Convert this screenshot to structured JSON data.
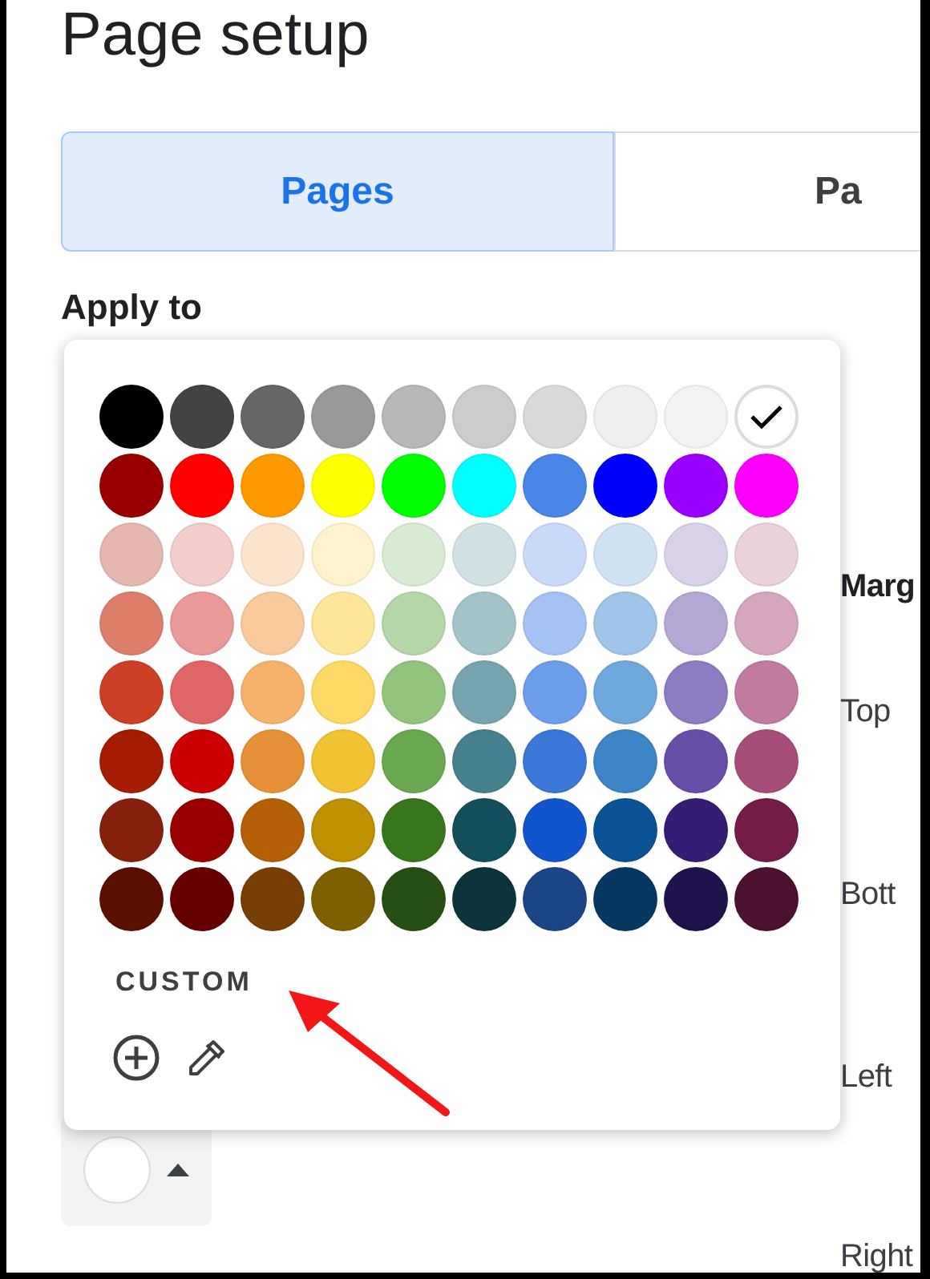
{
  "title": "Page setup",
  "tabs": [
    {
      "label": "Pages",
      "selected": true
    },
    {
      "label": "Pa",
      "selected": false
    }
  ],
  "apply_to": {
    "label": "Apply to"
  },
  "margins": {
    "heading": "Marg",
    "fields": [
      "Top",
      "Bott",
      "Left",
      "Right"
    ]
  },
  "color_button": {
    "color": "#ffffff"
  },
  "palette": {
    "rows": [
      [
        {
          "color": "#000000",
          "selected": false
        },
        {
          "color": "#434343",
          "selected": false
        },
        {
          "color": "#666666",
          "selected": false
        },
        {
          "color": "#999999",
          "selected": false
        },
        {
          "color": "#b7b7b7",
          "selected": false
        },
        {
          "color": "#cccccc",
          "selected": false
        },
        {
          "color": "#d9d9d9",
          "selected": false
        },
        {
          "color": "#efefef",
          "selected": false
        },
        {
          "color": "#f3f3f3",
          "selected": false
        },
        {
          "color": "#ffffff",
          "selected": true
        }
      ],
      [
        {
          "color": "#980000",
          "selected": false
        },
        {
          "color": "#ff0000",
          "selected": false
        },
        {
          "color": "#ff9900",
          "selected": false
        },
        {
          "color": "#ffff00",
          "selected": false
        },
        {
          "color": "#00ff00",
          "selected": false
        },
        {
          "color": "#00ffff",
          "selected": false
        },
        {
          "color": "#4a86e8",
          "selected": false
        },
        {
          "color": "#0000ff",
          "selected": false
        },
        {
          "color": "#9900ff",
          "selected": false
        },
        {
          "color": "#ff00ff",
          "selected": false
        }
      ],
      [
        {
          "color": "#e6b8af",
          "selected": false
        },
        {
          "color": "#f4cccc",
          "selected": false
        },
        {
          "color": "#fce5cd",
          "selected": false
        },
        {
          "color": "#fff2cc",
          "selected": false
        },
        {
          "color": "#d9ead3",
          "selected": false
        },
        {
          "color": "#d0e0e3",
          "selected": false
        },
        {
          "color": "#c9daf8",
          "selected": false
        },
        {
          "color": "#cfe2f3",
          "selected": false
        },
        {
          "color": "#d9d2e9",
          "selected": false
        },
        {
          "color": "#ead1dc",
          "selected": false
        }
      ],
      [
        {
          "color": "#dd7e6b",
          "selected": false
        },
        {
          "color": "#ea9999",
          "selected": false
        },
        {
          "color": "#f9cb9c",
          "selected": false
        },
        {
          "color": "#ffe599",
          "selected": false
        },
        {
          "color": "#b6d7a8",
          "selected": false
        },
        {
          "color": "#a2c4c9",
          "selected": false
        },
        {
          "color": "#a4c2f4",
          "selected": false
        },
        {
          "color": "#9fc5e8",
          "selected": false
        },
        {
          "color": "#b4a7d6",
          "selected": false
        },
        {
          "color": "#d5a6bd",
          "selected": false
        }
      ],
      [
        {
          "color": "#cc4125",
          "selected": false
        },
        {
          "color": "#e06666",
          "selected": false
        },
        {
          "color": "#f6b26b",
          "selected": false
        },
        {
          "color": "#ffd966",
          "selected": false
        },
        {
          "color": "#93c47d",
          "selected": false
        },
        {
          "color": "#76a5af",
          "selected": false
        },
        {
          "color": "#6d9eeb",
          "selected": false
        },
        {
          "color": "#6fa8dc",
          "selected": false
        },
        {
          "color": "#8e7cc3",
          "selected": false
        },
        {
          "color": "#c27ba0",
          "selected": false
        }
      ],
      [
        {
          "color": "#a61c00",
          "selected": false
        },
        {
          "color": "#cc0000",
          "selected": false
        },
        {
          "color": "#e69138",
          "selected": false
        },
        {
          "color": "#f1c232",
          "selected": false
        },
        {
          "color": "#6aa84f",
          "selected": false
        },
        {
          "color": "#45818e",
          "selected": false
        },
        {
          "color": "#3c78d8",
          "selected": false
        },
        {
          "color": "#3d85c6",
          "selected": false
        },
        {
          "color": "#674ea7",
          "selected": false
        },
        {
          "color": "#a64d79",
          "selected": false
        }
      ],
      [
        {
          "color": "#85200c",
          "selected": false
        },
        {
          "color": "#990000",
          "selected": false
        },
        {
          "color": "#b45f06",
          "selected": false
        },
        {
          "color": "#bf9000",
          "selected": false
        },
        {
          "color": "#38761d",
          "selected": false
        },
        {
          "color": "#134f5c",
          "selected": false
        },
        {
          "color": "#1155cc",
          "selected": false
        },
        {
          "color": "#0b5394",
          "selected": false
        },
        {
          "color": "#351c75",
          "selected": false
        },
        {
          "color": "#741b47",
          "selected": false
        }
      ],
      [
        {
          "color": "#5b0f00",
          "selected": false
        },
        {
          "color": "#660000",
          "selected": false
        },
        {
          "color": "#783f04",
          "selected": false
        },
        {
          "color": "#7f6000",
          "selected": false
        },
        {
          "color": "#274e13",
          "selected": false
        },
        {
          "color": "#0c343d",
          "selected": false
        },
        {
          "color": "#1c4587",
          "selected": false
        },
        {
          "color": "#073763",
          "selected": false
        },
        {
          "color": "#20124d",
          "selected": false
        },
        {
          "color": "#4c1130",
          "selected": false
        }
      ]
    ],
    "custom_label": "CUSTOM"
  }
}
